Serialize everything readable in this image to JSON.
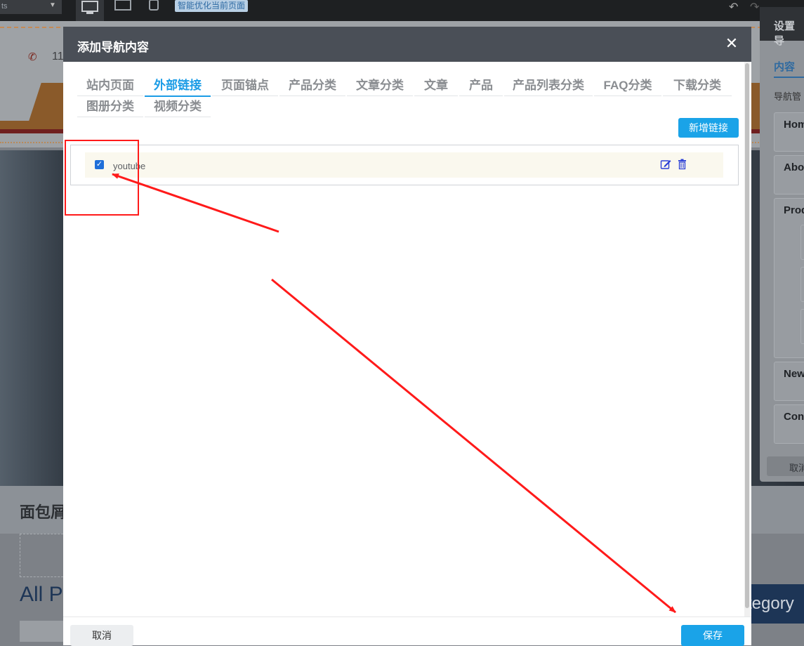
{
  "editor": {
    "select_fragment": "ts",
    "smart_optimize_label": "智能优化当前页面"
  },
  "background_page": {
    "phone_fragment": "11",
    "breadcrumb_fragment": "面包屑",
    "all_products_fragment": "All P",
    "category_fragment": "tegory"
  },
  "settings_panel": {
    "title_fragment": "设置导",
    "tab_fragment": "内容",
    "label_fragment": "导航管",
    "items": [
      "Hom",
      "Abo",
      "Prod",
      "New",
      "Cont"
    ],
    "cancel_fragment": "取消"
  },
  "modal": {
    "title": "添加导航内容",
    "close_icon": "close-icon",
    "tabs": [
      {
        "label": "站内页面",
        "active": false
      },
      {
        "label": "外部链接",
        "active": true
      },
      {
        "label": "页面锚点",
        "active": false
      },
      {
        "label": "产品分类",
        "active": false
      },
      {
        "label": "文章分类",
        "active": false
      },
      {
        "label": "文章",
        "active": false
      },
      {
        "label": "产品",
        "active": false
      },
      {
        "label": "产品列表分类",
        "active": false
      },
      {
        "label": "FAQ分类",
        "active": false
      },
      {
        "label": "下载分类",
        "active": false
      },
      {
        "label": "图册分类",
        "active": false
      },
      {
        "label": "视频分类",
        "active": false
      }
    ],
    "new_link_button": "新增链接",
    "links": [
      {
        "label": "youtube",
        "checked": true
      }
    ],
    "cancel_button": "取消",
    "save_button": "保存"
  },
  "annotation": {
    "color": "#ff1a1a"
  },
  "colors": {
    "accent": "#1aa3e8",
    "modal_header": "#4a4f57"
  }
}
